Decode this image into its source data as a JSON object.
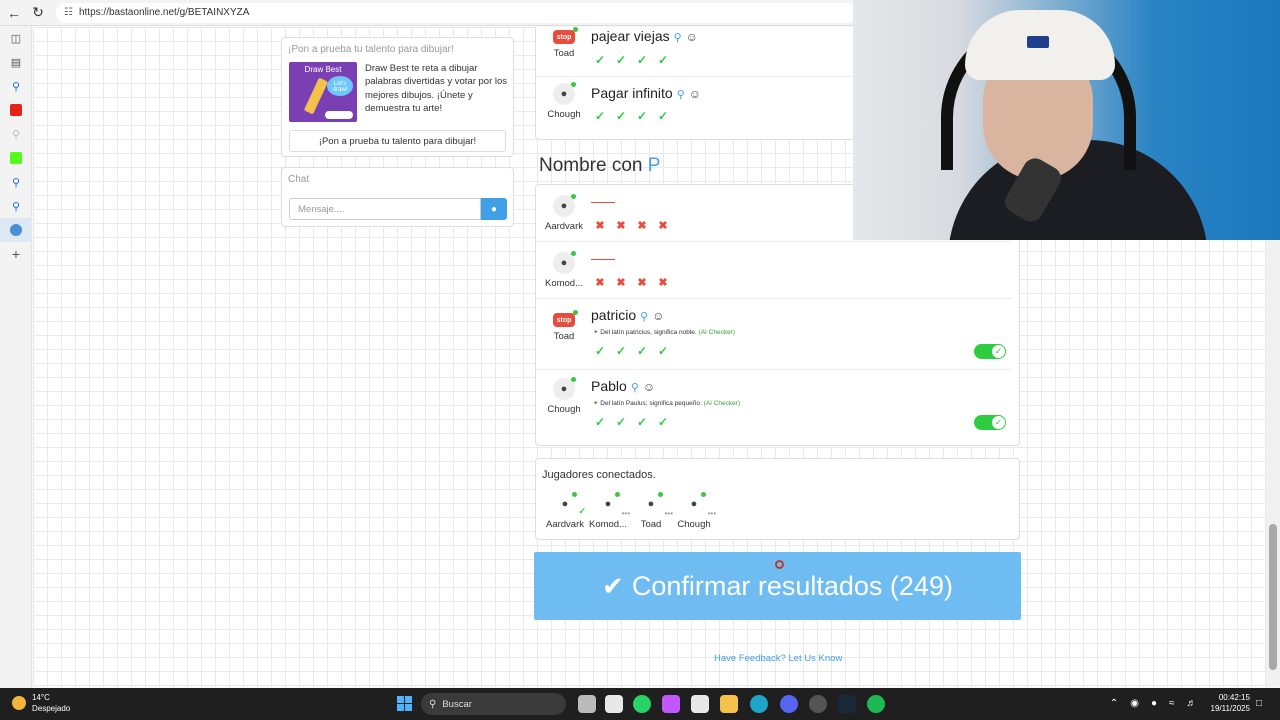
{
  "browser": {
    "url": "https://bastaonline.net/g/BETAINXYZA"
  },
  "promo": {
    "title": "¡Pon a prueba tu talento para dibujar!",
    "image_title": "Draw Best",
    "image_bubble": "Let's draw!",
    "description": "Draw Best te reta a dibujar palabras divertidas y votar por los mejores dibujos. ¡Únete y demuestra tu arte!",
    "button_label": "¡Pon a prueba tu talento para dibujar!"
  },
  "chat": {
    "title": "Chat",
    "placeholder": "Mensaje...."
  },
  "previous_section": {
    "rows": [
      {
        "player": "Toad",
        "word": "pajear viejas",
        "marks": [
          "ok",
          "ok",
          "ok",
          "ok"
        ],
        "stop": true
      },
      {
        "player": "Chough",
        "word": "Pagar infinito",
        "marks": [
          "ok",
          "ok",
          "ok",
          "ok"
        ],
        "stop": false
      }
    ]
  },
  "section": {
    "title_prefix": "Nombre con",
    "letter": "P",
    "rows": [
      {
        "player": "Aardvark",
        "word": "",
        "marks": [
          "no",
          "no",
          "no",
          "no"
        ],
        "stop": false,
        "note": "",
        "toggle": false
      },
      {
        "player": "Komod...",
        "word": "",
        "marks": [
          "no",
          "no",
          "no",
          "no"
        ],
        "stop": false,
        "note": "",
        "toggle": false
      },
      {
        "player": "Toad",
        "word": "patricio",
        "marks": [
          "ok",
          "ok",
          "ok",
          "ok"
        ],
        "stop": true,
        "note": "Del latín patricius, significa noble.",
        "ai": "(AI Checker)",
        "toggle": true
      },
      {
        "player": "Chough",
        "word": "Pablo",
        "marks": [
          "ok",
          "ok",
          "ok",
          "ok"
        ],
        "stop": false,
        "note": "Del latín Paulus; significa pequeño.",
        "ai": "(AI Checker)",
        "toggle": true
      }
    ]
  },
  "players": {
    "title": "Jugadores conectados.",
    "list": [
      "Aardvark",
      "Komod...",
      "Toad",
      "Chough"
    ]
  },
  "confirm": {
    "label": "Confirmar resultados (249)"
  },
  "feedback": {
    "label": "Have Feedback? Let Us Know"
  },
  "stop_badge": "stop",
  "taskbar": {
    "temp": "14°C",
    "weather": "Despejado",
    "search_placeholder": "Buscar",
    "time": "00:42:15",
    "date": "19/11/2025"
  },
  "colors": {
    "accent": "#3fa0e8",
    "confirm_bg": "#6ebcf2",
    "ok": "#2ecc40",
    "no": "#e74c3c"
  }
}
